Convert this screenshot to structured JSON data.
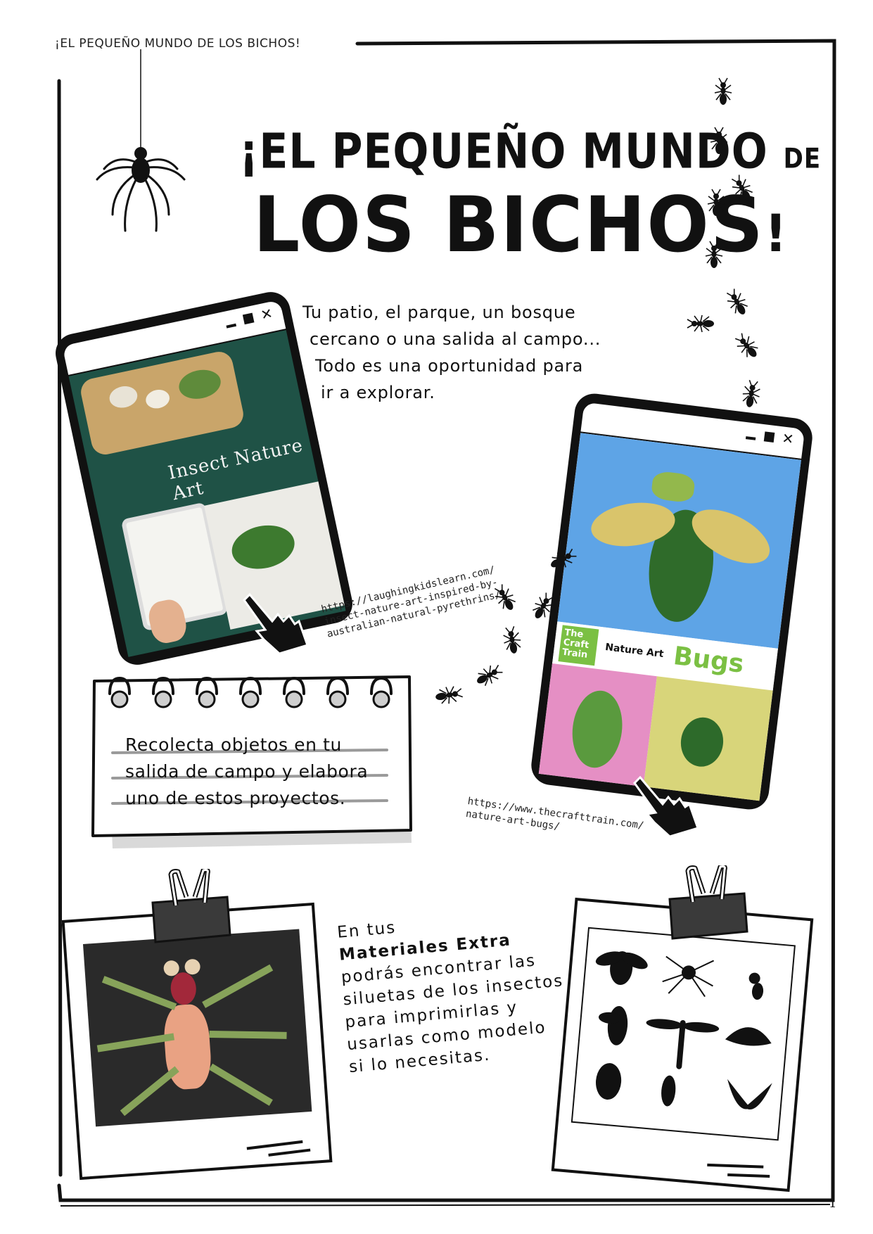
{
  "header": {
    "running_title": "¡EL PEQUEÑO MUNDO DE LOS BICHOS!"
  },
  "title": {
    "line1_main": "¡EL PEQUEÑO MUNDO",
    "line1_small": "DE",
    "line2": "LOS BICHOS",
    "line2_end": "!"
  },
  "intro": {
    "lines": [
      "Tu patio, el parque, un bosque",
      "cercano o una salida al campo...",
      "Todo es una oportunidad para",
      "ir a explorar."
    ]
  },
  "card1": {
    "image_caption": "Insect Nature Art",
    "url_lines": [
      "https://laughingkidslearn.com/",
      "insect-nature-art-inspired-by-",
      "australian-natural-pyrethrins/"
    ]
  },
  "card2": {
    "brand": "The Craft Train",
    "subtitle": "Nature Art",
    "word": "Bugs",
    "url_lines": [
      "https://www.thecrafttrain.com/",
      "nature-art-bugs/"
    ]
  },
  "note": {
    "lines": [
      "Recolecta objetos en tu",
      "salida de campo y elabora",
      "uno de estos proyectos."
    ]
  },
  "extra": {
    "line1": "En tus",
    "line2_bold": "Materiales Extra",
    "lines": [
      "podrás encontrar las",
      "siluetas de los insectos",
      "para imprimirlas y",
      "usarlas como modelo",
      "si lo necesitas."
    ]
  },
  "page_number": "1"
}
